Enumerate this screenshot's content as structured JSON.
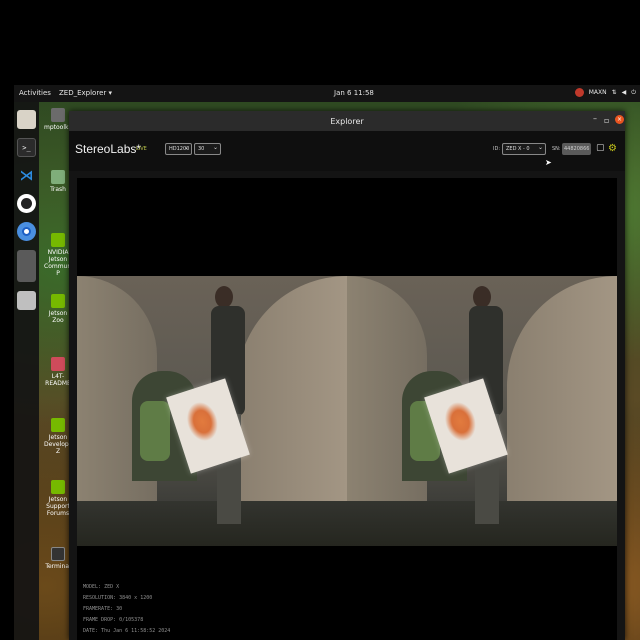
{
  "topbar": {
    "activities": "Activities",
    "app_menu": "ZED_Explorer ▾",
    "clock": "Jan 6 11:58",
    "power_mode": "MAXN"
  },
  "dock": {
    "items": [
      "files-icon",
      "terminal-icon",
      "vscode-icon",
      "obs-icon",
      "chromium-icon",
      "zed-explorer-icon",
      "disk-icon"
    ]
  },
  "desktop": {
    "icons": [
      {
        "label": "mptoolkit",
        "icon": "folder-icon"
      },
      {
        "label": "Trash",
        "icon": "trash-icon"
      },
      {
        "label": "NVIDIA Jetson Community P",
        "icon": "nvidia-icon"
      },
      {
        "label": "Jetson Zoo",
        "icon": "nvidia-icon"
      },
      {
        "label": "L4T-README",
        "icon": "document-icon"
      },
      {
        "label": "Jetson Developer Z",
        "icon": "nvidia-icon"
      },
      {
        "label": "Jetson Support Forums",
        "icon": "nvidia-icon"
      },
      {
        "label": "Terminal",
        "icon": "terminal-icon"
      }
    ]
  },
  "window": {
    "title": "Explorer",
    "brand": "StereoLabs*",
    "live_label": "LIVE",
    "resolution_select": "HD1200",
    "fps_select": "30",
    "id_label": "ID:",
    "camera_select": "ZED X - 0",
    "sn_label": "SN:",
    "serial_number": "44820866",
    "colors": {
      "accent": "#c9c91c",
      "close": "#e95420",
      "live": "#b8c24a"
    }
  },
  "camera_info": {
    "model": "MODEL: ZED X",
    "resolution": "RESOLUTION: 3840 x 1200",
    "framerate": "FRAMERATE: 30",
    "frame_drop": "FRAME DROP: 0/105378",
    "date": "DATE: Thu Jan 6 11:58:52 2024"
  }
}
